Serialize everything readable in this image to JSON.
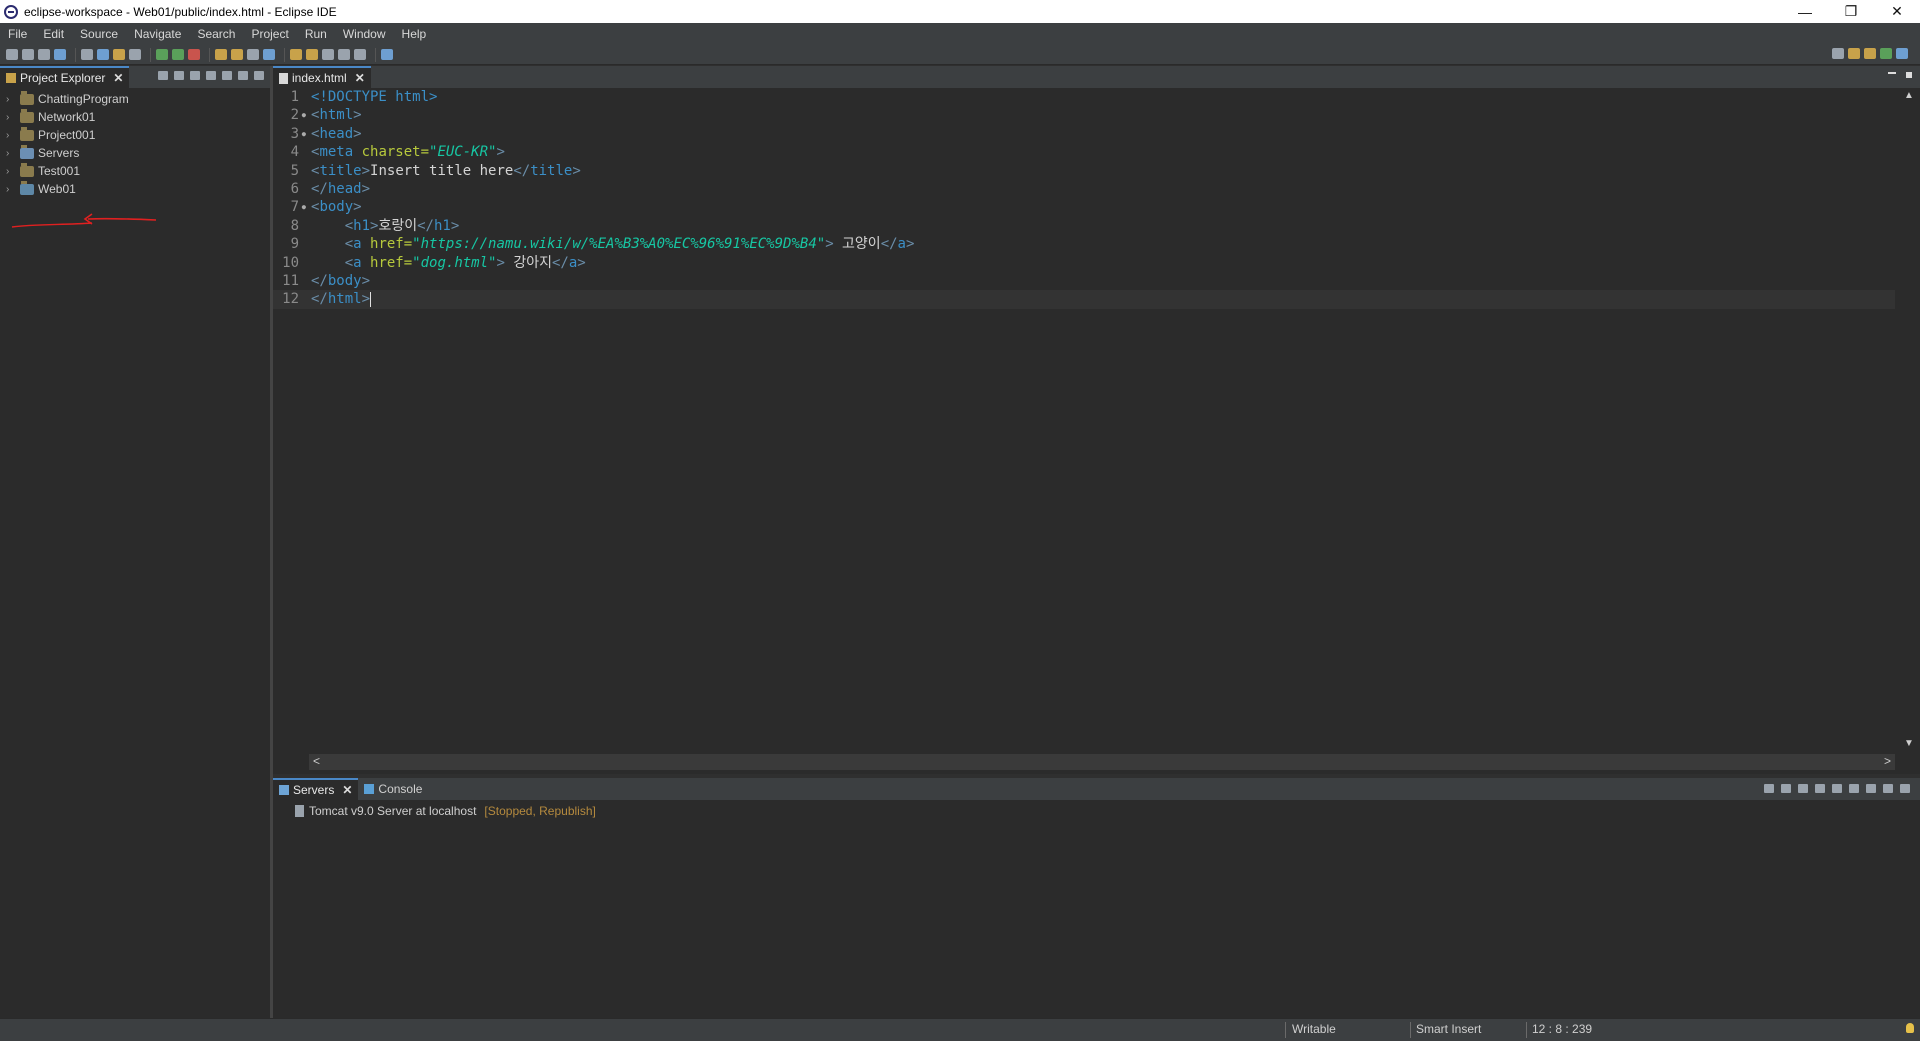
{
  "window": {
    "title": "eclipse-workspace - Web01/public/index.html - Eclipse IDE",
    "controls": {
      "minimize": "—",
      "restore": "❐",
      "close": "✕"
    }
  },
  "menu": [
    "File",
    "Edit",
    "Source",
    "Navigate",
    "Search",
    "Project",
    "Run",
    "Window",
    "Help"
  ],
  "project_explorer": {
    "tab_label": "Project Explorer",
    "close_glyph": "✕",
    "projects": [
      "ChattingProgram",
      "Network01",
      "Project001",
      "Servers",
      "Test001",
      "Web01"
    ]
  },
  "editor": {
    "tab_label": "index.html",
    "close_glyph": "✕",
    "line_numbers": [
      "1",
      "2",
      "3",
      "4",
      "5",
      "6",
      "7",
      "8",
      "9",
      "10",
      "11",
      "12"
    ],
    "lines": {
      "l1": {
        "a": "<!DOCTYPE",
        "b": " html>"
      },
      "l2": {
        "a": "<",
        "b": "html",
        "c": ">"
      },
      "l3": {
        "a": "<",
        "b": "head",
        "c": ">"
      },
      "l4": {
        "a": "<",
        "b": "meta",
        "c": " charset=",
        "d": "\"EUC-KR\"",
        "e": ">"
      },
      "l5": {
        "a": "<",
        "b": "title",
        "c": ">",
        "d": "Insert title here",
        "e": "</",
        "f": "title",
        "g": ">"
      },
      "l6": {
        "a": "</",
        "b": "head",
        "c": ">"
      },
      "l7": {
        "a": "<",
        "b": "body",
        "c": ">"
      },
      "l8": {
        "indent": "    ",
        "a": "<",
        "b": "h1",
        "c": ">",
        "d": "호랑이",
        "e": "</",
        "f": "h1",
        "g": ">"
      },
      "l9": {
        "indent": "    ",
        "a": "<",
        "b": "a",
        "c": " href=",
        "d": "\"https://namu.wiki/w/%EA%B3%A0%EC%96%91%EC%9D%B4\"",
        "e": "> ",
        "f": "고양이",
        "g": "</",
        "h": "a",
        "i": ">"
      },
      "l10": {
        "indent": "    ",
        "a": "<",
        "b": "a",
        "c": " href=",
        "d": "\"dog.html\"",
        "e": "> ",
        "f": "강아지",
        "g": "</",
        "h": "a",
        "i": ">"
      },
      "l11": {
        "a": "</",
        "b": "body",
        "c": ">"
      },
      "l12": {
        "a": "</",
        "b": "html",
        "c": ">"
      }
    },
    "scroll": {
      "up": "▲",
      "down": "▼",
      "left": "<",
      "right": ">"
    }
  },
  "bottom_panel": {
    "tabs": [
      {
        "label": "Servers",
        "close_glyph": "✕"
      },
      {
        "label": "Console"
      }
    ],
    "server": {
      "name": "Tomcat v9.0 Server at localhost",
      "status": "[Stopped, Republish]"
    }
  },
  "status_bar": {
    "writable": "Writable",
    "insert_mode": "Smart Insert",
    "position": "12 : 8 : 239"
  },
  "colors": {
    "background": "#2b2b2b",
    "tag": "#3b8fc7",
    "attribute": "#b7c93c",
    "attribute_value": "#17c6a3",
    "annotation_red": "#e02020"
  }
}
